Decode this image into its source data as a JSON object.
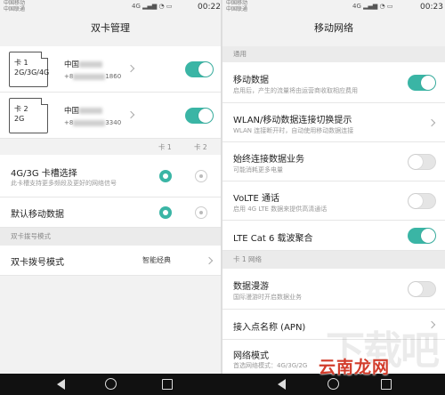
{
  "left": {
    "status": {
      "carrier1": "中国移动",
      "carrier2": "中国联通",
      "signal": "4G",
      "time": "00:22"
    },
    "title": "双卡管理",
    "sim1": {
      "icon_line1": "卡 1",
      "icon_line2": "2G/3G/4G",
      "name": "中国",
      "number_prefix": "+8",
      "number_suffix": "1860",
      "enabled": true
    },
    "sim2": {
      "icon_line1": "卡 2",
      "icon_line2": "2G",
      "name": "中国",
      "number_prefix": "+8",
      "number_suffix": "3340",
      "enabled": true
    },
    "col_card1": "卡 1",
    "col_card2": "卡 2",
    "slot_select": {
      "title": "4G/3G 卡槽选择",
      "subtitle": "此卡槽支持更多频段及更好的网络信号"
    },
    "default_data": {
      "title": "默认移动数据"
    },
    "section_dial": "双卡拨号模式",
    "dial_mode": {
      "title": "双卡拨号模式",
      "value": "智能经典"
    }
  },
  "right": {
    "status": {
      "carrier1": "中国移动",
      "carrier2": "中国联通",
      "signal": "4G",
      "time": "00:23"
    },
    "title": "移动网络",
    "section_general": "通用",
    "mobile_data": {
      "title": "移动数据",
      "subtitle": "启用后，产生的流量将由运营商收取相应费用",
      "on": true
    },
    "wlan_switch": {
      "title": "WLAN/移动数据连接切换提示",
      "subtitle": "WLAN 连接断开时，自动使用移动数据连接"
    },
    "always_on": {
      "title": "始终连接数据业务",
      "subtitle": "可能消耗更多电量",
      "on": false
    },
    "volte": {
      "title": "VoLTE 通话",
      "subtitle": "启用 4G LTE 数据来提供高清通话",
      "on": false
    },
    "lte_cat6": {
      "title": "LTE Cat 6 载波聚合",
      "on": true
    },
    "section_card1": "卡 1 网络",
    "roaming": {
      "title": "数据漫游",
      "subtitle": "国际漫游时开启数据业务",
      "on": false
    },
    "apn": {
      "title": "接入点名称 (APN)"
    },
    "network_mode": {
      "title": "网络模式",
      "subtitle": "首选网络模式：4G/3G/2G"
    }
  },
  "watermark": "云南龙网",
  "watermark_bg": "下载吧",
  "colors": {
    "accent": "#3ab5a5",
    "watermark": "#d23c2b"
  }
}
